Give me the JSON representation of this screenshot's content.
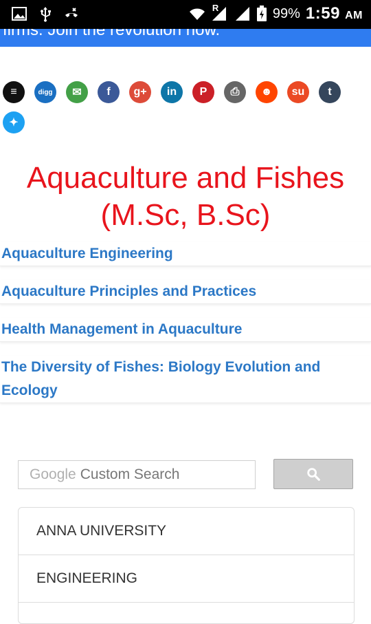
{
  "status_bar": {
    "battery": "99%",
    "time": "1:59",
    "ampm": "AM",
    "network": "R"
  },
  "banner": {
    "text": "firms. Join the revolution now."
  },
  "share_icons": [
    {
      "name": "buffer-icon",
      "color": "#111111",
      "glyph": "≡"
    },
    {
      "name": "digg-icon",
      "color": "#1a6fc2",
      "glyph": "digg"
    },
    {
      "name": "email-icon",
      "color": "#43a047",
      "glyph": "✉"
    },
    {
      "name": "facebook-icon",
      "color": "#3b5998",
      "glyph": "f"
    },
    {
      "name": "google-plus-icon",
      "color": "#dd4b39",
      "glyph": "g+"
    },
    {
      "name": "linkedin-icon",
      "color": "#0e76a8",
      "glyph": "in"
    },
    {
      "name": "pinterest-icon",
      "color": "#cb2027",
      "glyph": "P"
    },
    {
      "name": "print-icon",
      "color": "#666666",
      "glyph": "⎙"
    },
    {
      "name": "reddit-icon",
      "color": "#ff4500",
      "glyph": "☻"
    },
    {
      "name": "stumbleupon-icon",
      "color": "#eb4924",
      "glyph": "su"
    },
    {
      "name": "tumblr-icon",
      "color": "#35465c",
      "glyph": "t"
    },
    {
      "name": "twitter-icon",
      "color": "#1da1f2",
      "glyph": "✦"
    }
  ],
  "page": {
    "title_line1": "Aquaculture and Fishes",
    "title_line2": "(M.Sc, B.Sc)"
  },
  "links": [
    "Aquaculture Engineering",
    "Aquaculture Principles and Practices",
    "Health Management in Aquaculture",
    "The Diversity of Fishes: Biology Evolution and Ecology"
  ],
  "search": {
    "google_label": "Google",
    "placeholder": "Custom Search"
  },
  "menu": [
    "ANNA UNIVERSITY",
    "ENGINEERING"
  ]
}
